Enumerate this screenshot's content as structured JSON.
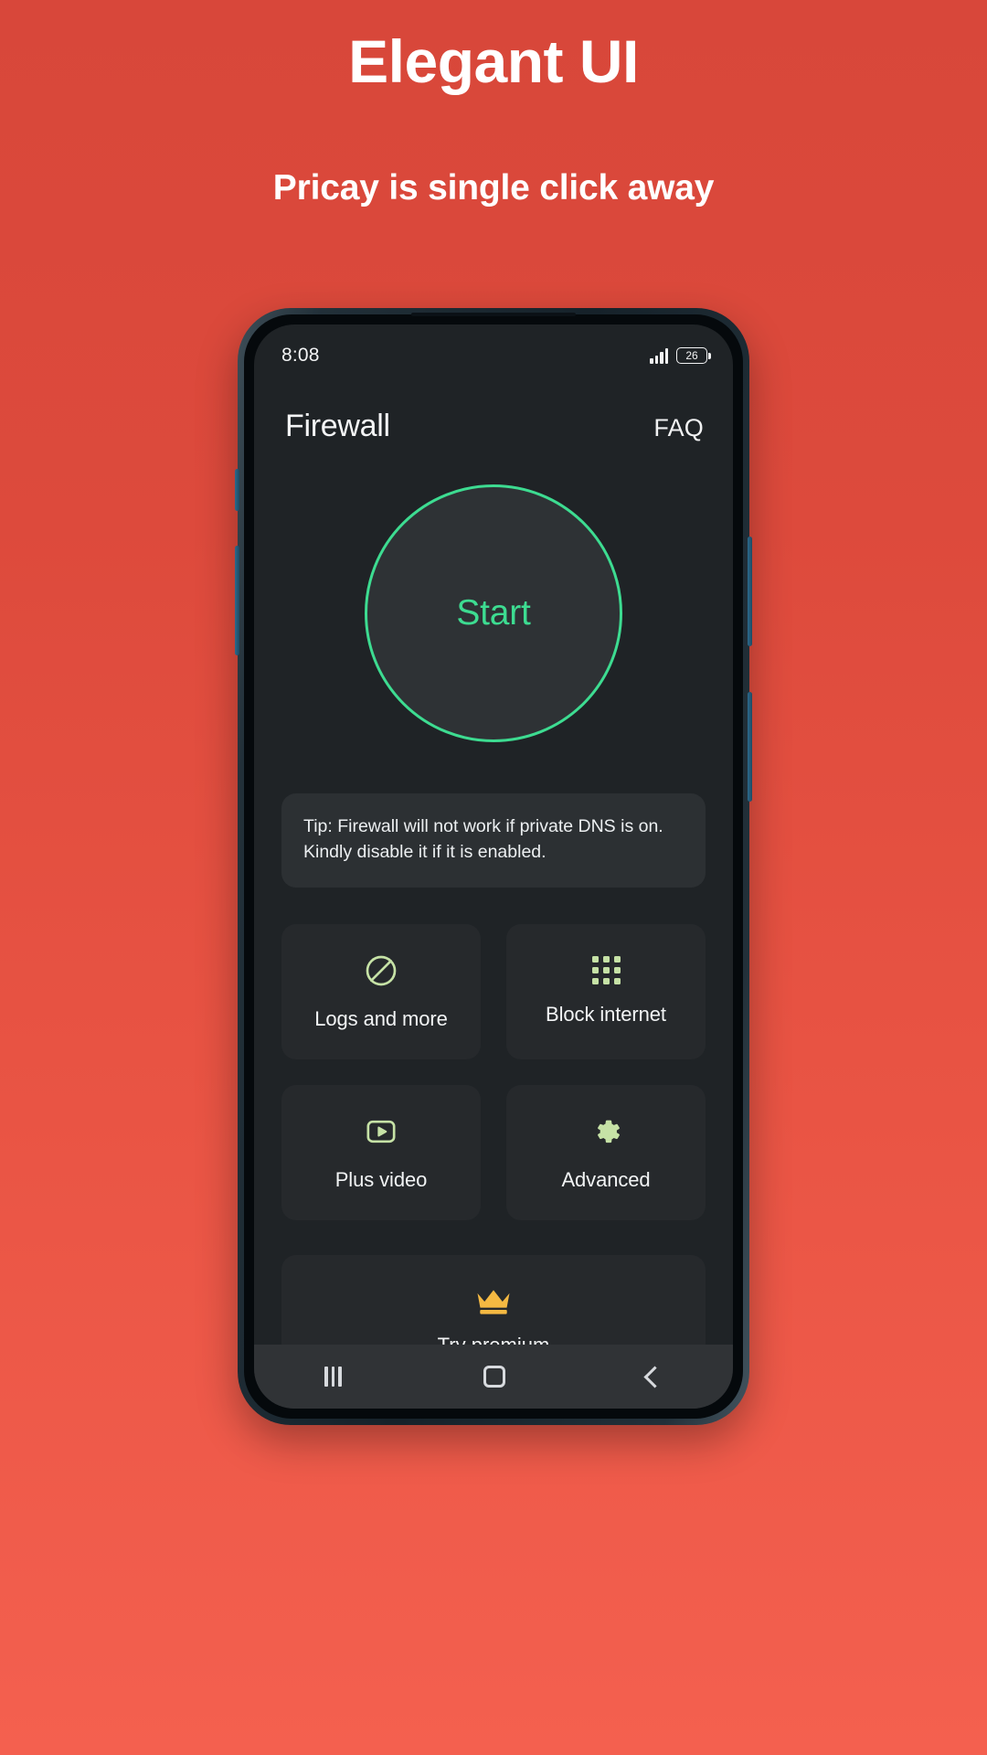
{
  "promo": {
    "title": "Elegant UI",
    "subtitle": "Pricay is single click away"
  },
  "colors": {
    "background_start": "#d8473a",
    "background_end": "#f4604f",
    "accent_green": "#3ddc91",
    "icon_green": "#c6e2a6",
    "crown_gold": "#f5b942",
    "screen_bg": "#1f2326",
    "card_bg": "#26292c",
    "tip_bg": "#2c3033"
  },
  "phone": {
    "statusbar": {
      "time": "8:08",
      "signal_icon": "signal-bars-icon",
      "signal_strength": 4,
      "battery_level": "26",
      "battery_icon": "battery-icon"
    },
    "header": {
      "title": "Firewall",
      "faq_label": "FAQ"
    },
    "start_button": {
      "label": "Start"
    },
    "tip": {
      "text": "Tip: Firewall will not work if private DNS is on. Kindly disable it if it is enabled."
    },
    "tiles": [
      {
        "label": "Logs and more",
        "icon": "block-circle-icon"
      },
      {
        "label": "Block internet",
        "icon": "grid-dots-icon"
      },
      {
        "label": "Plus video",
        "icon": "play-video-icon"
      },
      {
        "label": "Advanced",
        "icon": "gear-icon"
      }
    ],
    "premium": {
      "label": "Try premium",
      "icon": "crown-icon"
    },
    "navbar": {
      "recents_label": "Recents",
      "home_label": "Home",
      "back_label": "Back"
    }
  }
}
